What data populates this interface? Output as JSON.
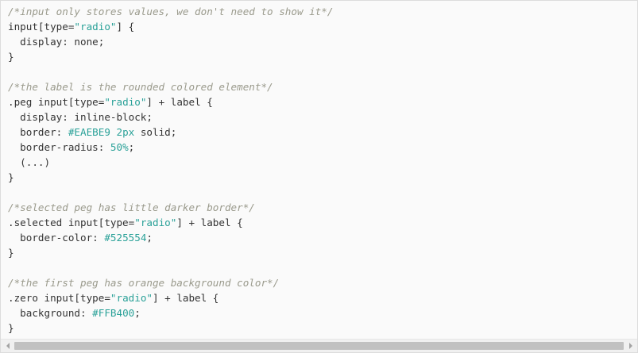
{
  "code": {
    "lines": [
      [
        {
          "t": "cm",
          "v": "/*input only stores values, we don't need to show it*/"
        }
      ],
      [
        {
          "t": "pl",
          "v": "input[type="
        },
        {
          "t": "str",
          "v": "\"radio\""
        },
        {
          "t": "pl",
          "v": "] {"
        }
      ],
      [
        {
          "t": "pl",
          "v": "  display: none;"
        }
      ],
      [
        {
          "t": "pl",
          "v": "}"
        }
      ],
      [],
      [
        {
          "t": "cm",
          "v": "/*the label is the rounded colored element*/"
        }
      ],
      [
        {
          "t": "pl",
          "v": ".peg input[type="
        },
        {
          "t": "str",
          "v": "\"radio\""
        },
        {
          "t": "pl",
          "v": "] + label {"
        }
      ],
      [
        {
          "t": "pl",
          "v": "  display: inline-block;"
        }
      ],
      [
        {
          "t": "pl",
          "v": "  border: "
        },
        {
          "t": "num",
          "v": "#EAEBE9"
        },
        {
          "t": "pl",
          "v": " "
        },
        {
          "t": "num",
          "v": "2px"
        },
        {
          "t": "pl",
          "v": " solid;"
        }
      ],
      [
        {
          "t": "pl",
          "v": "  border-radius: "
        },
        {
          "t": "num",
          "v": "50%"
        },
        {
          "t": "pl",
          "v": ";"
        }
      ],
      [
        {
          "t": "pl",
          "v": "  (...)"
        }
      ],
      [
        {
          "t": "pl",
          "v": "}"
        }
      ],
      [],
      [
        {
          "t": "cm",
          "v": "/*selected peg has little darker border*/"
        }
      ],
      [
        {
          "t": "pl",
          "v": ".selected input[type="
        },
        {
          "t": "str",
          "v": "\"radio\""
        },
        {
          "t": "pl",
          "v": "] + label {"
        }
      ],
      [
        {
          "t": "pl",
          "v": "  border-color: "
        },
        {
          "t": "num",
          "v": "#525554"
        },
        {
          "t": "pl",
          "v": ";"
        }
      ],
      [
        {
          "t": "pl",
          "v": "}"
        }
      ],
      [],
      [
        {
          "t": "cm",
          "v": "/*the first peg has orange background color*/"
        }
      ],
      [
        {
          "t": "pl",
          "v": ".zero input[type="
        },
        {
          "t": "str",
          "v": "\"radio\""
        },
        {
          "t": "pl",
          "v": "] + label {"
        }
      ],
      [
        {
          "t": "pl",
          "v": "  background: "
        },
        {
          "t": "num",
          "v": "#FFB400"
        },
        {
          "t": "pl",
          "v": ";"
        }
      ],
      [
        {
          "t": "pl",
          "v": "}"
        }
      ]
    ]
  },
  "scrollbar": {
    "left_icon": "triangle-left-icon",
    "right_icon": "triangle-right-icon",
    "thumb_fraction": 1.0
  },
  "colors": {
    "background": "#fafafa",
    "comment": "#9a9a8c",
    "string": "#2aa198",
    "text": "#333333"
  }
}
